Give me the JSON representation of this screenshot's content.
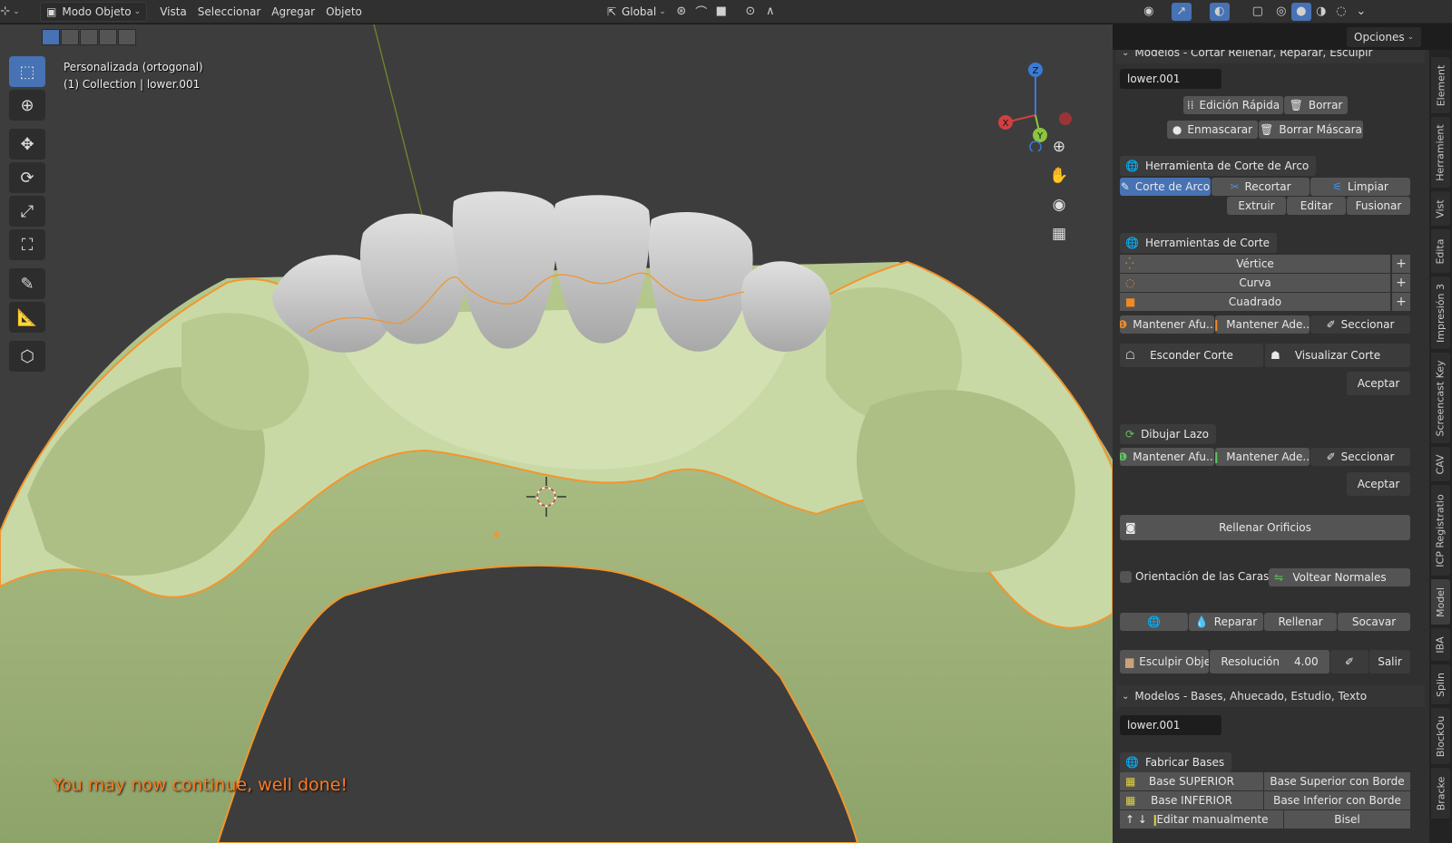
{
  "header": {
    "mode": "Modo Objeto",
    "menus": [
      "Vista",
      "Seleccionar",
      "Agregar",
      "Objeto"
    ],
    "orientation": "Global",
    "options": "Opciones"
  },
  "viewport": {
    "view_name": "Personalizada (ortogonal)",
    "collection": "(1) Collection | lower.001",
    "message": "You may now continue, well done!",
    "gizmo": {
      "x": "X",
      "y": "Y",
      "z": "Z"
    }
  },
  "sidebar": {
    "panel1_title": "Modelos - Cortar Rellenar, Reparar, Esculpir",
    "object_name": "lower.001",
    "edicion_rapida": "Edición Rápida",
    "borrar": "Borrar",
    "enmascarar": "Enmascarar",
    "borrar_mascara": "Borrar Máscara",
    "arco_title": "Herramienta de Corte de Arco",
    "corte_arco": "Corte de Arco",
    "recortar": "Recortar",
    "limpiar": "Limpiar",
    "extruir": "Extruir",
    "editar": "Editar",
    "fusionar": "Fusionar",
    "corte_title": "Herramientas de Corte",
    "vertice": "Vértice",
    "curva": "Curva",
    "cuadrado": "Cuadrado",
    "mantener_afu": "Mantener Afu...",
    "mantener_ade": "Mantener Ade...",
    "seccionar": "Seccionar",
    "esconder_corte": "Esconder Corte",
    "visualizar_corte": "Visualizar Corte",
    "aceptar": "Aceptar",
    "lazo_title": "Dibujar Lazo",
    "rellenar_orificios": "Rellenar Orificios",
    "orientacion": "Orientación de las Caras",
    "voltear": "Voltear Normales",
    "reparar": "Reparar",
    "rellenar": "Rellenar",
    "socavar": "Socavar",
    "esculpir": "Esculpir Obje...",
    "resolucion_label": "Resolución",
    "resolucion_value": "4.00",
    "salir": "Salir",
    "panel2_title": "Modelos - Bases, Ahuecado, Estudio, Texto",
    "object_name2": "lower.001",
    "bases_title": "Fabricar Bases",
    "base_superior": "Base SUPERIOR",
    "base_superior_borde": "Base Superior con Borde",
    "base_inferior": "Base INFERIOR",
    "base_inferior_borde": "Base Inferior con Borde",
    "editar_manual": "Editar manualmente",
    "bisel": "Bisel"
  },
  "tabs": [
    "Element",
    "Herramient",
    "Vist",
    "Edita",
    "Impresión 3",
    "Screencast Key",
    "CAV",
    "ICP Registratio",
    "Model",
    "IBA",
    "Splin",
    "BlockOu",
    "Bracke"
  ],
  "active_tab": "Model",
  "colors": {
    "accent": "#4772b3",
    "model_green": "#c9d9a6",
    "teeth": "#bfbfbf",
    "outline": "#f2962e",
    "message": "#ff7a20"
  }
}
